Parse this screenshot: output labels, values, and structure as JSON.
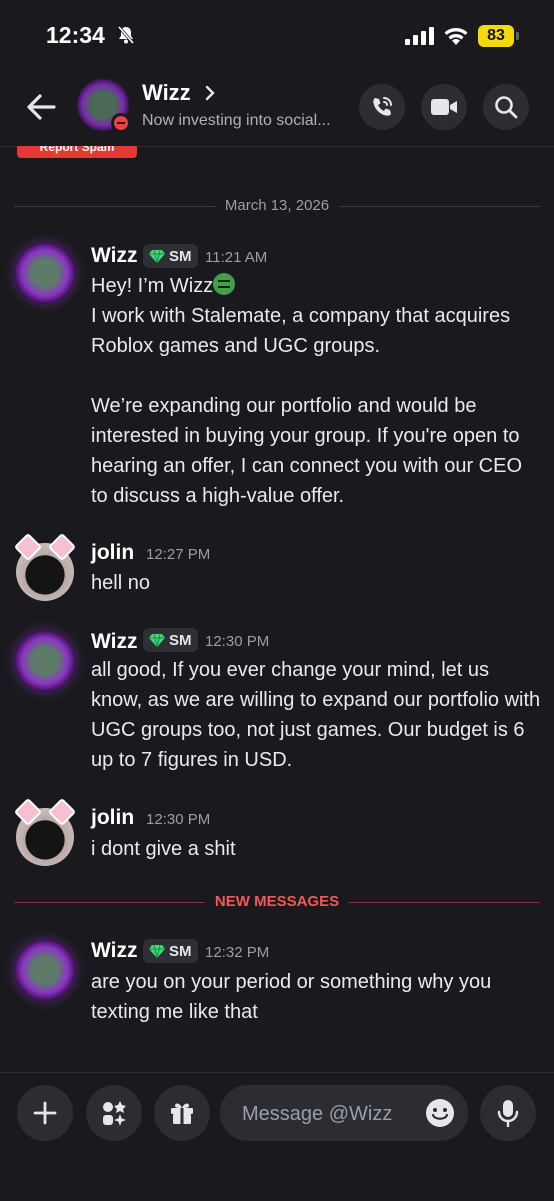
{
  "status_bar": {
    "time": "12:34",
    "battery": "83"
  },
  "header": {
    "name": "Wizz",
    "status": "Now investing into social..."
  },
  "report_spam": "Report Spam",
  "date_separator": "March 13, 2026",
  "new_messages_label": "NEW MESSAGES",
  "messages": [
    {
      "author": "Wizz",
      "tag": "SM",
      "time": "11:21 AM",
      "lines": [
        "Hey! I’m Wizz",
        "I work with Stalemate, a company that acquires Roblox games and UGC groups.",
        "We’re expanding our portfolio and would be interested in buying your group. If you're open to hearing an offer, I can connect you with our CEO to discuss a high-value offer."
      ]
    },
    {
      "author": "jolin",
      "time": "12:27 PM",
      "lines": [
        "hell no"
      ]
    },
    {
      "author": "Wizz",
      "tag": "SM",
      "time": "12:30 PM",
      "lines": [
        "all good, If you ever change your mind, let us know, as we are willing to expand our portfolio with UGC groups too, not just games. Our budget is 6 up to 7 figures in USD."
      ]
    },
    {
      "author": "jolin",
      "time": "12:30 PM",
      "lines": [
        "i dont give a shit"
      ]
    },
    {
      "author": "Wizz",
      "tag": "SM",
      "time": "12:32 PM",
      "lines": [
        "are you on your period or something why you texting me like that"
      ]
    }
  ],
  "composer": {
    "placeholder": "Message @Wizz"
  },
  "icons": {
    "back": "arrow-left-icon",
    "call": "phone-icon",
    "video": "video-camera-icon",
    "search": "search-icon",
    "add": "plus-icon",
    "apps": "apps-icon",
    "gift": "gift-icon",
    "emoji": "emoji-icon",
    "mic": "microphone-icon"
  },
  "colors": {
    "background": "#1a1a1e",
    "new_messages": "#f2585b",
    "battery": "#f5d90a",
    "report": "#e53935"
  }
}
